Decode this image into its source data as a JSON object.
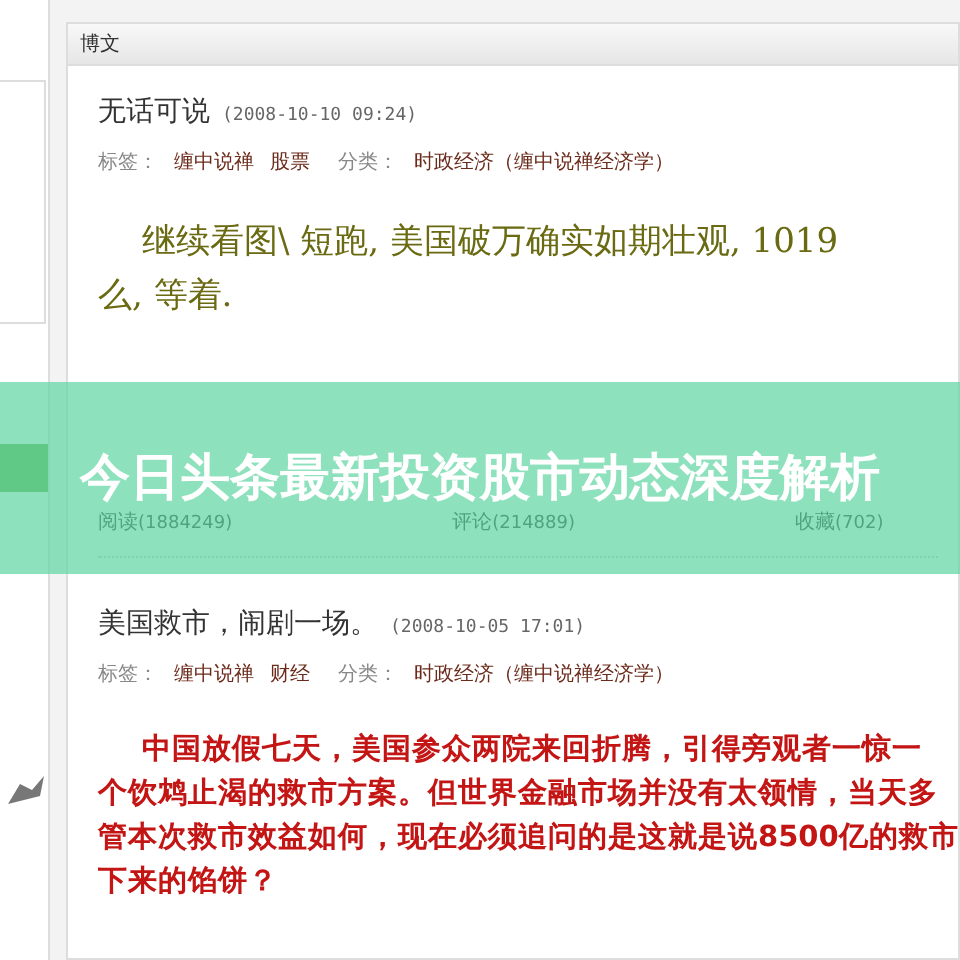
{
  "panel": {
    "title": "博文"
  },
  "posts": [
    {
      "title": "无话可说",
      "time": "(2008-10-10 09:24)",
      "tags_label": "标签：",
      "tags": [
        "缠中说禅",
        "股票"
      ],
      "category_label": "分类：",
      "category": "时政经济（缠中说禅经济学）",
      "kind": "olive",
      "lines": [
        "继续看图\\  短跑, 美国破万确实如期壮观, 1019",
        "么, 等着."
      ],
      "stats": [
        {
          "label": "阅读",
          "count": "(1884249)"
        },
        {
          "label": "评论",
          "count": "(214889)"
        },
        {
          "label": "收藏",
          "count": "(702)"
        }
      ]
    },
    {
      "title": "美国救市，闹剧一场。",
      "time": "(2008-10-05 17:01)",
      "tags_label": "标签：",
      "tags": [
        "缠中说禅",
        "财经"
      ],
      "category_label": "分类：",
      "category": "时政经济（缠中说禅经济学）",
      "kind": "red",
      "lines": [
        "中国放假七天，美国参众两院来回折腾，引得旁观者一惊一",
        "个饮鸩止渴的救市方案。但世界金融市场并没有太领情，当天多",
        "管本次救市效益如何，现在必须追问的是这就是说8500亿的救市",
        "下来的馅饼？"
      ]
    }
  ],
  "banner": {
    "title": "今日头条最新投资股市动态深度解析"
  }
}
